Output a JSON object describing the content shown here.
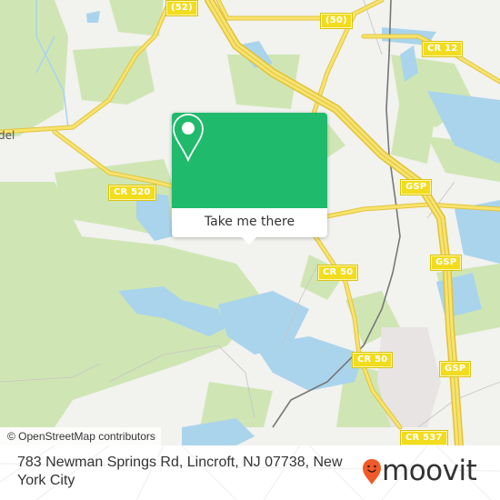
{
  "map": {
    "place_labels": [
      {
        "name": "town-label",
        "text": "del"
      }
    ],
    "road_shields": [
      {
        "id": "shield-52",
        "text": "(52)"
      },
      {
        "id": "shield-50-north",
        "text": "(50)"
      },
      {
        "id": "shield-cr12",
        "text": "CR 12"
      },
      {
        "id": "shield-cr520",
        "text": "CR 520"
      },
      {
        "id": "shield-gsp-1",
        "text": "GSP"
      },
      {
        "id": "shield-gsp-2",
        "text": "GSP"
      },
      {
        "id": "shield-cr50-1",
        "text": "CR 50"
      },
      {
        "id": "shield-cr50-2",
        "text": "CR 50"
      },
      {
        "id": "shield-gsp-3",
        "text": "GSP"
      },
      {
        "id": "shield-cr537",
        "text": "CR 537"
      }
    ],
    "attribution": "© OpenStreetMap contributors",
    "colors": {
      "land": "#f2f2ef",
      "forest": "#c8e2a8",
      "water": "#a9d4ec",
      "road_major": "#f6e36c",
      "road_outline": "#e8c93a",
      "rail": "#7a7a7a",
      "industrial": "#e8e2e2"
    }
  },
  "popup": {
    "icon": "map-pin-icon",
    "button_label": "Take me there",
    "color": "#1fba6b"
  },
  "footer": {
    "address": "783 Newman Springs Rd, Lincroft, NJ 07738, New York City",
    "brand": "moovit",
    "brand_icon": "moovit-smiley-pin-icon",
    "brand_color": "#f05a28"
  }
}
